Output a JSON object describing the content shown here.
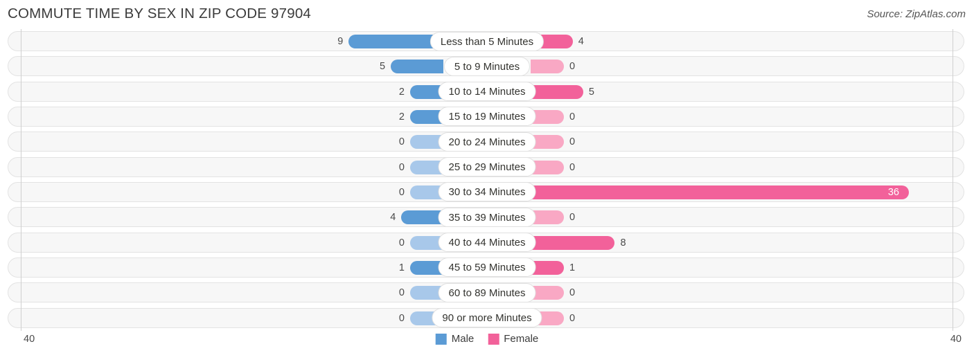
{
  "header": {
    "title": "COMMUTE TIME BY SEX IN ZIP CODE 97904",
    "source": "Source: ZipAtlas.com"
  },
  "footer": {
    "axis_left_max": "40",
    "axis_right_max": "40",
    "legend": [
      {
        "label": "Male",
        "color": "#5b9bd5"
      },
      {
        "label": "Female",
        "color": "#f2619a"
      }
    ]
  },
  "colors": {
    "male_strong": "#5b9bd5",
    "male_light": "#a8c8ea",
    "female_strong": "#f2619a",
    "female_light": "#f9a8c4",
    "track_fill": "#f7f7f7",
    "track_border": "#e3e3e3",
    "axis_line": "#cfcfcf"
  },
  "chart_data": {
    "type": "bar",
    "title": "COMMUTE TIME BY SEX IN ZIP CODE 97904",
    "subtitle": "",
    "orientation": "horizontal-diverging",
    "xlabel": "",
    "ylabel": "",
    "axis_max": 40,
    "grid": false,
    "legend_position": "bottom-center",
    "categories": [
      "Less than 5 Minutes",
      "5 to 9 Minutes",
      "10 to 14 Minutes",
      "15 to 19 Minutes",
      "20 to 24 Minutes",
      "25 to 29 Minutes",
      "30 to 34 Minutes",
      "35 to 39 Minutes",
      "40 to 44 Minutes",
      "45 to 59 Minutes",
      "60 to 89 Minutes",
      "90 or more Minutes"
    ],
    "series": [
      {
        "name": "Male",
        "color": "#5b9bd5",
        "values": [
          9,
          5,
          2,
          2,
          0,
          0,
          0,
          4,
          0,
          1,
          0,
          0
        ]
      },
      {
        "name": "Female",
        "color": "#f2619a",
        "values": [
          4,
          0,
          5,
          0,
          0,
          0,
          36,
          0,
          8,
          1,
          0,
          0
        ]
      }
    ]
  }
}
